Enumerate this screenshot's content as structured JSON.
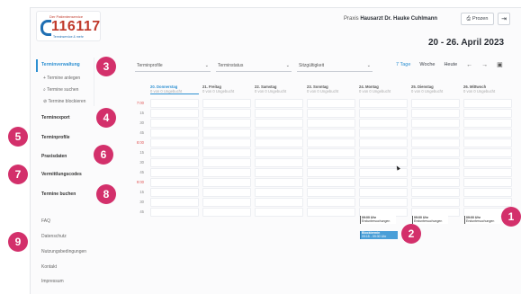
{
  "logo": {
    "tagline": "Der Patientenservice",
    "number": "116117",
    "subline": "Terminservice & mehr"
  },
  "header": {
    "practice_prefix": "Praxis",
    "practice_name": "Hausarzt Dr. Hauke Cuhlmann",
    "print_label": "Prozen",
    "date_range": "20 - 26. April 2023"
  },
  "filters": [
    {
      "label": "Terminprofile"
    },
    {
      "label": "Terminstatus"
    },
    {
      "label": "Sitzgültigkeit"
    }
  ],
  "view": {
    "days": "7 Tage",
    "week": "Woche",
    "today": "Heute"
  },
  "sidebar": {
    "terminverwaltung": "Terminverwaltung",
    "termin_anlegen": "Termine anlegen",
    "termin_suchen": "Termine suchen",
    "termin_blockieren": "Termine blockieren",
    "terminexport": "Terminexport",
    "terminprofile": "Terminprofile",
    "praxisdaten": "Praxisdaten",
    "vermittlungscodes": "Vermittlungscodes",
    "termine_buchen": "Termine buchen",
    "faq": "FAQ",
    "datenschutz": "Datenschutz",
    "nutzungsbedingungen": "Nutzungsbedingungen",
    "kontakt": "Kontakt",
    "impressum": "Impressum"
  },
  "days": [
    {
      "day": "20. Donnerstag",
      "sub": "0 von 0 Ungebucht"
    },
    {
      "day": "21. Freitag",
      "sub": "0 von 0 Ungebucht"
    },
    {
      "day": "22. Samstag",
      "sub": "0 von 0 Ungebucht"
    },
    {
      "day": "23. Sonntag",
      "sub": "0 von 0 Ungebucht"
    },
    {
      "day": "24. Montag",
      "sub": "0 von 0 Ungebucht"
    },
    {
      "day": "25. Dienstag",
      "sub": "0 von 0 Ungebucht"
    },
    {
      "day": "26. Mittwoch",
      "sub": "0 von 0 Ungebucht"
    }
  ],
  "times": [
    "7:00",
    "15",
    "30",
    "45",
    "8:00",
    "15",
    "30",
    "45",
    "9:00",
    "15",
    "30",
    "45"
  ],
  "appointments": [
    {
      "time": "09:00 Uhr",
      "label": "Erstuntersuchungen"
    },
    {
      "time": "09:00 Uhr",
      "label": "Erstuntersuchungen"
    },
    {
      "time": "09:00 Uhr",
      "label": "Erstuntersuchungen"
    },
    {
      "time": "Blocktermin",
      "label": "09:15 - 09:30 Uhr"
    }
  ],
  "badges": [
    "1",
    "2",
    "3",
    "4",
    "5",
    "6",
    "7",
    "8",
    "9"
  ],
  "colors": {
    "accent": "#2c8fd1",
    "badge": "#d3306b",
    "hour_label": "#e05656",
    "logo_red": "#c0392b"
  }
}
